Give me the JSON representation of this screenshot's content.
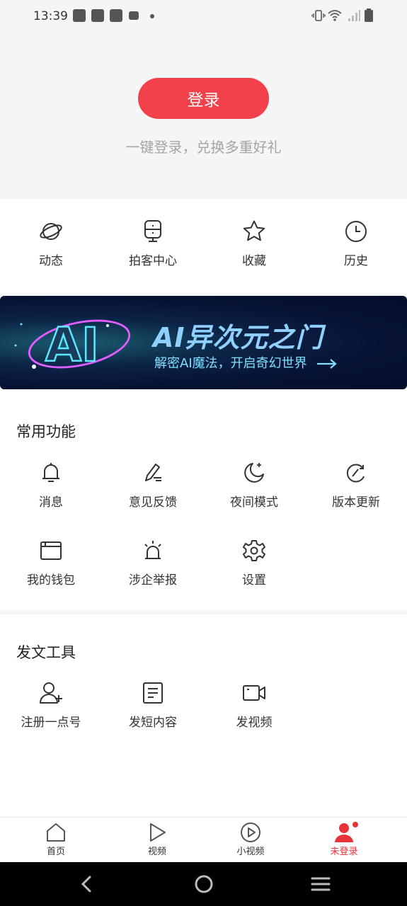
{
  "status_bar": {
    "time": "13:39"
  },
  "header": {
    "login_label": "登录",
    "subtitle": "一键登录，兑换多重好礼"
  },
  "quick_actions": [
    {
      "label": "动态",
      "icon": "planet-icon"
    },
    {
      "label": "拍客中心",
      "icon": "camera-monitor-icon"
    },
    {
      "label": "收藏",
      "icon": "star-icon"
    },
    {
      "label": "历史",
      "icon": "clock-icon"
    }
  ],
  "banner": {
    "title": "AI异次元之门",
    "subtitle": "解密AI魔法，开启奇幻世界",
    "logo_text": "AI"
  },
  "common_functions": {
    "title": "常用功能",
    "items": [
      {
        "label": "消息",
        "icon": "bell-icon"
      },
      {
        "label": "意见反馈",
        "icon": "pencil-icon"
      },
      {
        "label": "夜间模式",
        "icon": "moon-icon"
      },
      {
        "label": "版本更新",
        "icon": "refresh-icon"
      },
      {
        "label": "我的钱包",
        "icon": "wallet-icon"
      },
      {
        "label": "涉企举报",
        "icon": "alarm-icon"
      },
      {
        "label": "设置",
        "icon": "gear-icon"
      }
    ]
  },
  "publish_tools": {
    "title": "发文工具",
    "items": [
      {
        "label": "注册一点号",
        "icon": "user-add-icon"
      },
      {
        "label": "发短内容",
        "icon": "document-icon"
      },
      {
        "label": "发视频",
        "icon": "video-camera-icon"
      }
    ]
  },
  "bottom_nav": [
    {
      "label": "首页",
      "icon": "home-icon"
    },
    {
      "label": "视频",
      "icon": "play-icon"
    },
    {
      "label": "小视频",
      "icon": "play-circle-icon"
    },
    {
      "label": "未登录",
      "icon": "user-icon",
      "active": true
    }
  ],
  "colors": {
    "accent": "#f2414a",
    "background": "#f4f5f7",
    "text": "#333333",
    "muted": "#a5a5a5"
  }
}
